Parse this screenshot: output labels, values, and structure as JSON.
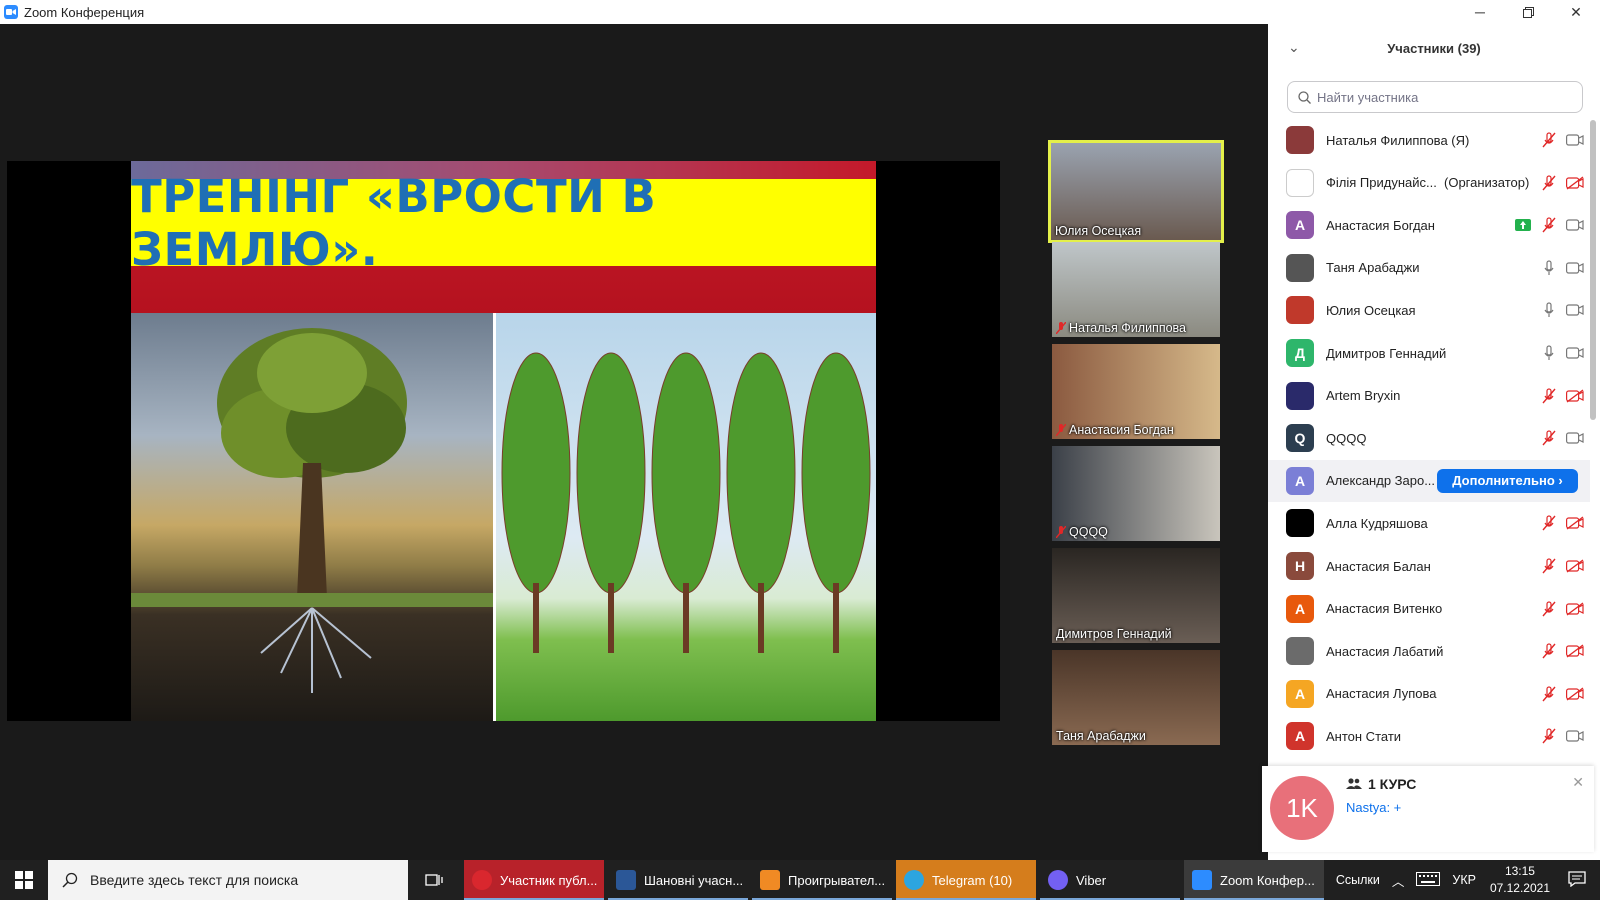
{
  "window": {
    "title": "Zoom Конференция"
  },
  "slide": {
    "title": "ТРЕНІНГ «ВРОСТИ В ЗЕМЛЮ»."
  },
  "gallery": [
    {
      "name": "Юлия Осецкая",
      "muted": false,
      "active": true
    },
    {
      "name": "Наталья Филиппова",
      "muted": true
    },
    {
      "name": "Анастасия Богдан",
      "muted": true
    },
    {
      "name": "QQQQ",
      "muted": true
    },
    {
      "name": "Димитров Геннадий",
      "muted": false
    },
    {
      "name": "Таня Арабаджи",
      "muted": false
    }
  ],
  "panel": {
    "title": "Участники (39)",
    "search_placeholder": "Найти участника",
    "more_label": "Дополнительно ›",
    "participants": [
      {
        "name": "Наталья Филиппова (Я)",
        "role": "",
        "avatar": "",
        "avatar_color": "#8b3a3a",
        "mic": "muted",
        "video": "on"
      },
      {
        "name": "Філія Придунайс...",
        "role": "(Организатор)",
        "avatar": "",
        "avatar_color": "#ffffff",
        "mic": "muted",
        "video": "off"
      },
      {
        "name": "Анастасия Богдан",
        "role": "",
        "avatar": "A",
        "avatar_color": "#8e59a8",
        "mic": "muted",
        "video": "on",
        "share": true
      },
      {
        "name": "Таня Арабаджи",
        "role": "",
        "avatar": "",
        "avatar_color": "#555555",
        "mic": "on",
        "video": "on"
      },
      {
        "name": "Юлия Осецкая",
        "role": "",
        "avatar": "",
        "avatar_color": "#c0392b",
        "mic": "on",
        "video": "on"
      },
      {
        "name": "Димитров Геннадий",
        "role": "",
        "avatar": "Д",
        "avatar_color": "#2eb66b",
        "mic": "on",
        "video": "on"
      },
      {
        "name": "Artem Bryxin",
        "role": "",
        "avatar": "",
        "avatar_color": "#2a2a6a",
        "mic": "muted",
        "video": "off"
      },
      {
        "name": "QQQQ",
        "role": "",
        "avatar": "Q",
        "avatar_color": "#2c3e50",
        "mic": "muted",
        "video": "on"
      },
      {
        "name": "Александр Заро...",
        "role": "",
        "avatar": "A",
        "avatar_color": "#7b7fd6",
        "mic": "",
        "video": "",
        "hover": true
      },
      {
        "name": "Алла Кудряшова",
        "role": "",
        "avatar": "",
        "avatar_color": "#000000",
        "mic": "muted",
        "video": "off"
      },
      {
        "name": "Анастасия Балан",
        "role": "",
        "avatar": "H",
        "avatar_color": "#8a4a3c",
        "mic": "muted",
        "video": "off"
      },
      {
        "name": "Анастасия Витенко",
        "role": "",
        "avatar": "A",
        "avatar_color": "#e8590c",
        "mic": "muted",
        "video": "off"
      },
      {
        "name": "Анастасия Лабатий",
        "role": "",
        "avatar": "",
        "avatar_color": "#6b6b6b",
        "mic": "muted",
        "video": "off"
      },
      {
        "name": "Анастасия Лупова",
        "role": "",
        "avatar": "A",
        "avatar_color": "#f5a623",
        "mic": "muted",
        "video": "off"
      },
      {
        "name": "Антон Стати",
        "role": "",
        "avatar": "A",
        "avatar_color": "#d0342c",
        "mic": "muted",
        "video": "on"
      }
    ]
  },
  "notification": {
    "avatar": "1K",
    "title": "1 КУРС",
    "message": "Nastya: +"
  },
  "taskbar": {
    "search_placeholder": "Введите здесь текст для поиска",
    "apps": [
      {
        "label": "Участник публ...",
        "icon": "opera-icon",
        "color": "#d9272e",
        "bg": "#b8222a"
      },
      {
        "label": "Шановні учасн...",
        "icon": "word-icon",
        "color": "#2b5797",
        "bg": "#202020"
      },
      {
        "label": "Проигрывател...",
        "icon": "player-icon",
        "color": "#f08a24",
        "bg": "#202020"
      },
      {
        "label": "Telegram (10)",
        "icon": "telegram-icon",
        "color": "#2ca5e0",
        "bg": "#d57d1c"
      },
      {
        "label": "Viber",
        "icon": "viber-icon",
        "color": "#7360f2",
        "bg": "#202020"
      },
      {
        "label": "Zoom Конфер...",
        "icon": "zoom-icon",
        "color": "#2d8cff",
        "bg": "#3b3b3b"
      }
    ],
    "tray": {
      "links": "Ссылки",
      "lang": "УКР",
      "time": "13:15",
      "date": "07.12.2021"
    }
  }
}
